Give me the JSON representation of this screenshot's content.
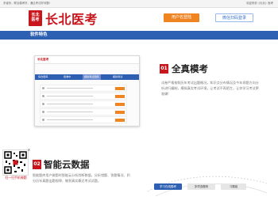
{
  "topbar": {
    "left_text": "多省份，联合模考好，通过考试好问题!",
    "right_text": "欢迎来到《长北》医考"
  },
  "header": {
    "logo_seal": "长北医考",
    "logo_text": "长北医考",
    "login_button": "用户名登陆",
    "wechat_button": "微信扫码登录"
  },
  "navbar": {
    "title": "软件特色"
  },
  "shot1": {
    "logo": "长北医考",
    "tabs": [
      "综合题库",
      "组卷中",
      "模拟考试题库",
      "模拟考试"
    ]
  },
  "feature1": {
    "number": "01",
    "title": "全真模考",
    "description": "试卷严格按照历年考试出题概况，知识点分布情况及今年命题方向分析进行编制，模拟真实考试环境，让考试不再陌生，让你学习考试更准确!"
  },
  "feature2": {
    "number": "02",
    "title": "智能云数据",
    "description": "智能题库用户做题时智能云分析判断数据，分析错题、答题情况、积分历年真题出题规律、做到真实最近考试试题。"
  },
  "qr": {
    "label": "扫一扫手机做题",
    "close": "x"
  },
  "shot2": {
    "pills": [
      "学习在线模考",
      "多项选题练",
      "习题组"
    ]
  },
  "colors": {
    "brand_red": "#c8161d",
    "brand_blue": "#2d5fb2",
    "accent_orange": "#f08421"
  }
}
